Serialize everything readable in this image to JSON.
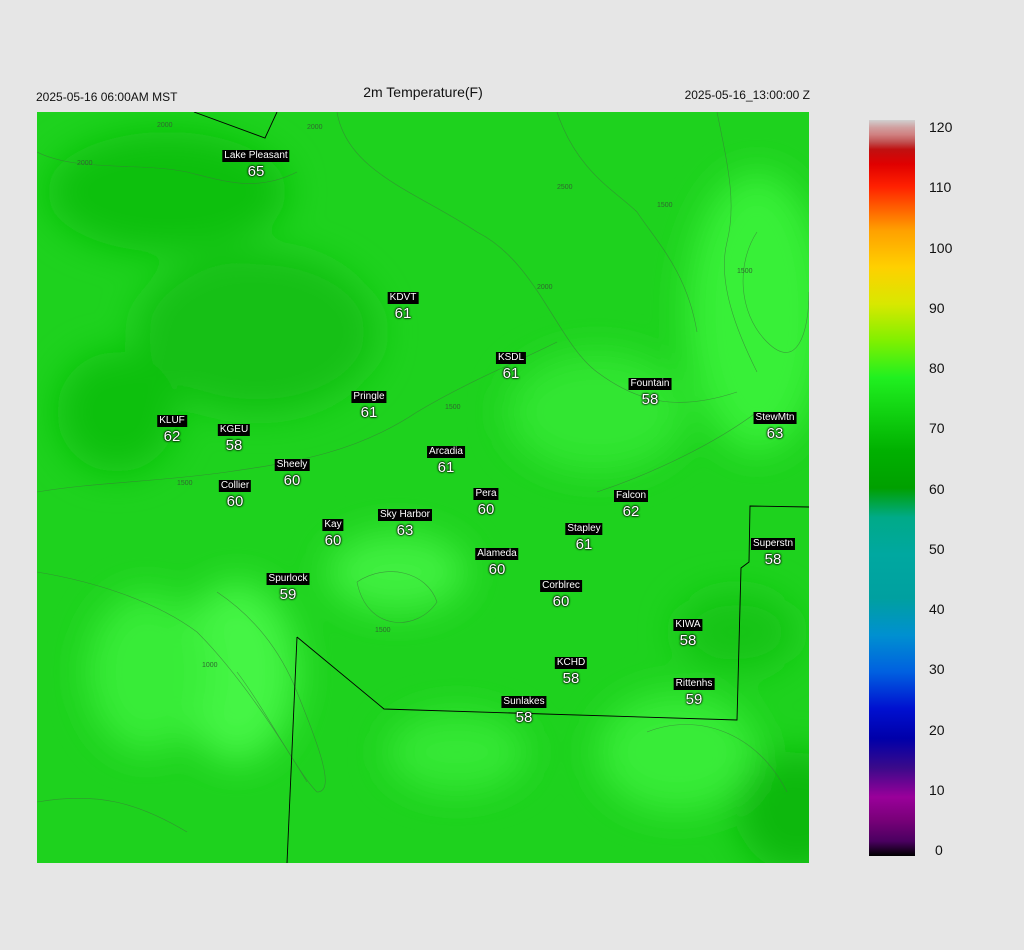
{
  "header": {
    "local_time": "2025-05-16 06:00AM MST",
    "title": "2m Temperature(F)",
    "valid_time": "2025-05-16_13:00:00 Z"
  },
  "stations": [
    {
      "name": "Lake Pleasant",
      "value": "65"
    },
    {
      "name": "KDVT",
      "value": "61"
    },
    {
      "name": "KSDL",
      "value": "61"
    },
    {
      "name": "Fountain",
      "value": "58"
    },
    {
      "name": "StewMtn",
      "value": "63"
    },
    {
      "name": "Pringle",
      "value": "61"
    },
    {
      "name": "KLUF",
      "value": "62"
    },
    {
      "name": "KGEU",
      "value": "58"
    },
    {
      "name": "Arcadia",
      "value": "61"
    },
    {
      "name": "Sheely",
      "value": "60"
    },
    {
      "name": "Collier",
      "value": "60"
    },
    {
      "name": "Pera",
      "value": "60"
    },
    {
      "name": "Falcon",
      "value": "62"
    },
    {
      "name": "Kay",
      "value": "60"
    },
    {
      "name": "Sky Harbor",
      "value": "63"
    },
    {
      "name": "Stapley",
      "value": "61"
    },
    {
      "name": "Superstn",
      "value": "58"
    },
    {
      "name": "Alameda",
      "value": "60"
    },
    {
      "name": "Spurlock",
      "value": "59"
    },
    {
      "name": "Corblrec",
      "value": "60"
    },
    {
      "name": "KIWA",
      "value": "58"
    },
    {
      "name": "KCHD",
      "value": "58"
    },
    {
      "name": "Rittenhs",
      "value": "59"
    },
    {
      "name": "Sunlakes",
      "value": "58"
    }
  ],
  "contour_labels": [
    "2000",
    "2000",
    "2000",
    "2500",
    "2000",
    "1500",
    "1500",
    "1500",
    "1500",
    "1500",
    "1000"
  ],
  "colorbar": {
    "ticks": [
      "120",
      "110",
      "100",
      "90",
      "80",
      "70",
      "60",
      "50",
      "40",
      "30",
      "20",
      "10",
      "0"
    ]
  }
}
